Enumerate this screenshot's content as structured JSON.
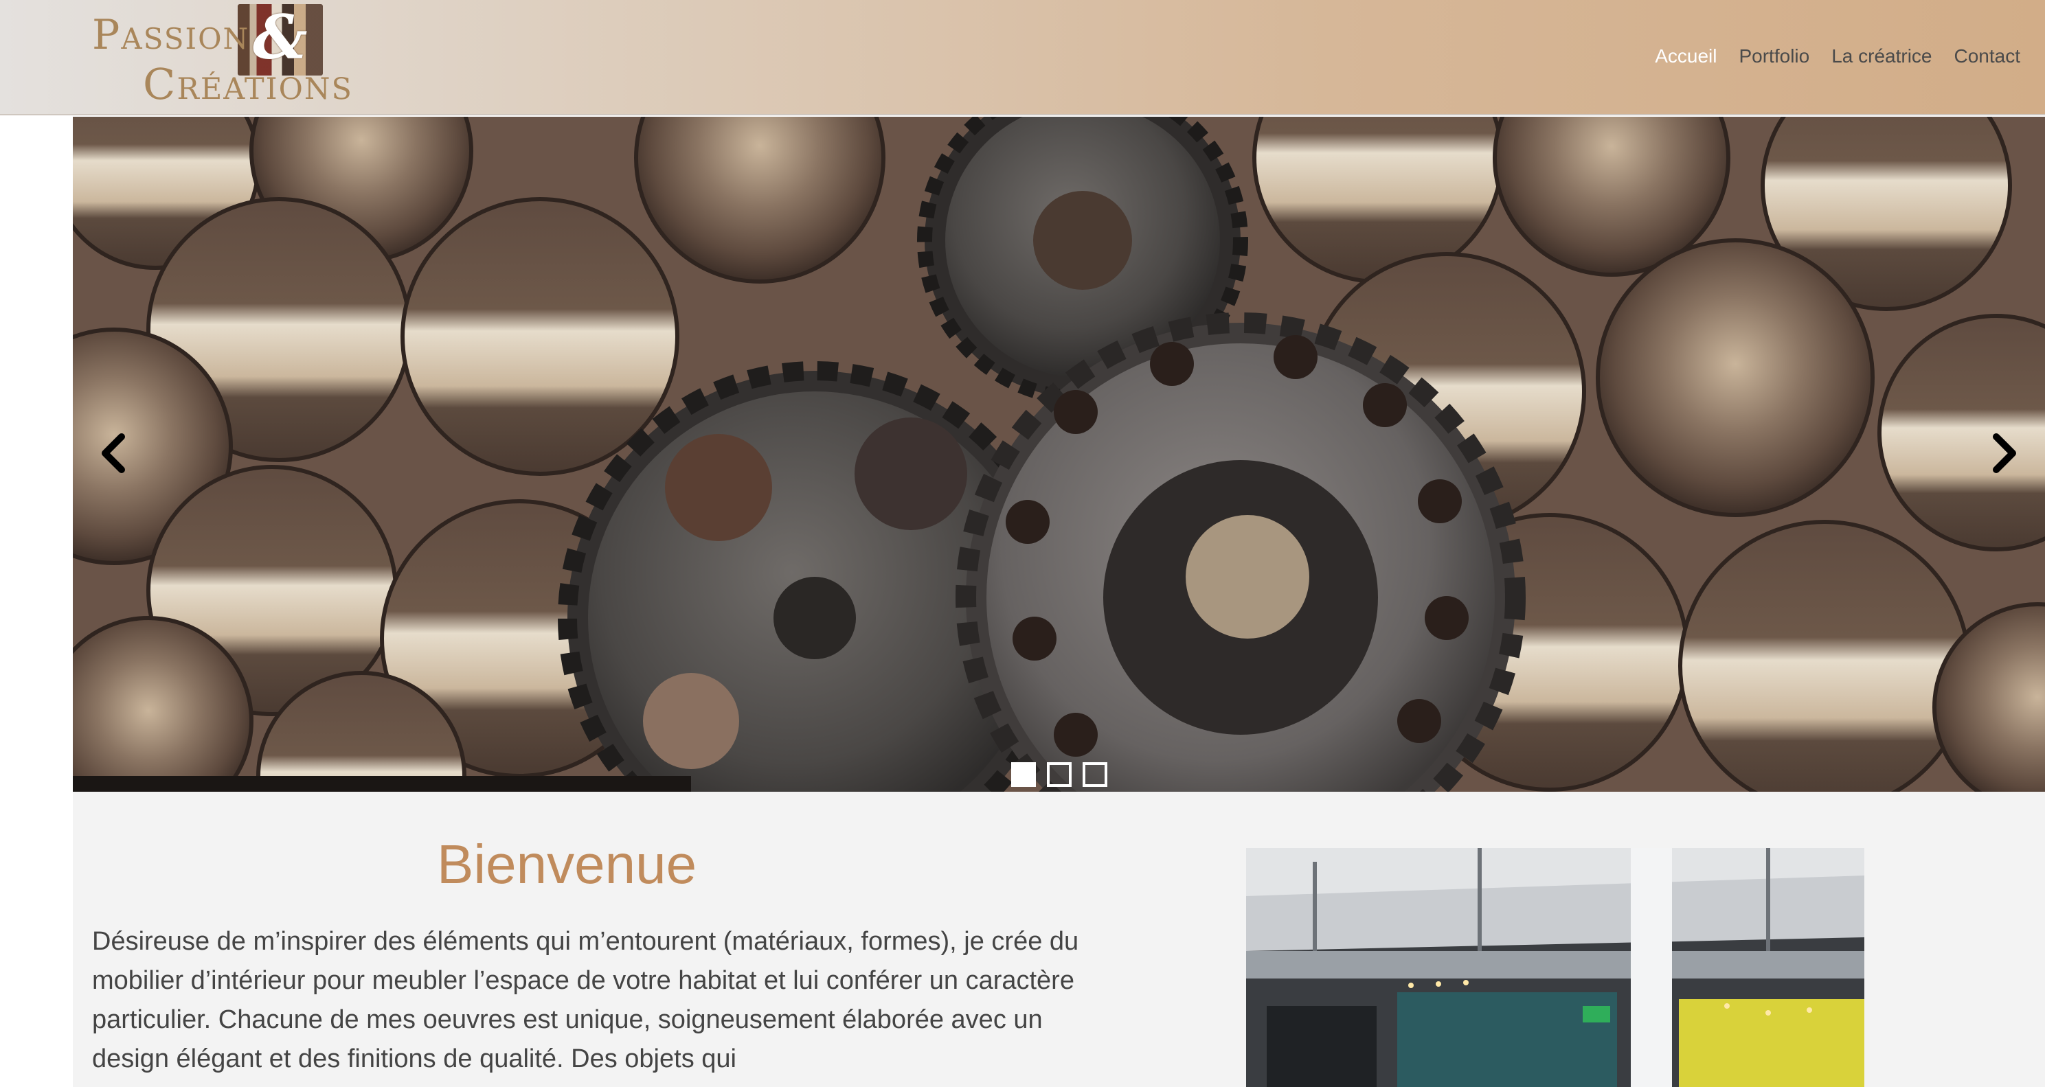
{
  "brand": {
    "logo_line1": "Passion",
    "logo_amp": "&",
    "logo_line2": "Créations"
  },
  "nav": {
    "items": [
      {
        "label": "Accueil",
        "active": true
      },
      {
        "label": "Portfolio",
        "active": false
      },
      {
        "label": "La créatrice",
        "active": false
      },
      {
        "label": "Contact",
        "active": false
      }
    ]
  },
  "carousel": {
    "slide_count": 3,
    "active_index": 0,
    "prev_icon": "chevron-left-icon",
    "next_icon": "chevron-right-icon"
  },
  "welcome": {
    "title": "Bienvenue",
    "text": "Désireuse de m’inspirer des éléments qui m’entourent (matériaux, formes), je crée du mobilier d’intérieur pour meubler l’espace de votre habitat et lui conférer un caractère particulier. Chacune de mes oeuvres est unique, soigneusement élaborée avec un design élégant et des finitions de qualité. Des objets qui"
  },
  "colors": {
    "accent": "#c08b5c",
    "nav_active": "#ffffff",
    "nav_text": "#4a4a4a",
    "content_bg": "#f3f3f3"
  }
}
